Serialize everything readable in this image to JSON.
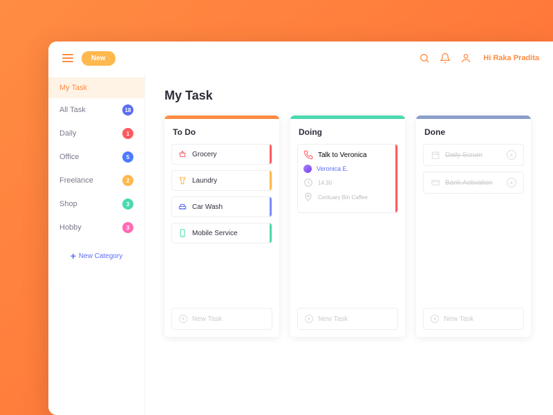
{
  "header": {
    "new_label": "New",
    "greeting": "Hi Raka Pradita"
  },
  "sidebar": {
    "items": [
      {
        "label": "My Task",
        "badge": null,
        "active": true
      },
      {
        "label": "All Task",
        "badge": "18",
        "color": "#5b6df5"
      },
      {
        "label": "Daily",
        "badge": "1",
        "color": "#ff5a5f"
      },
      {
        "label": "Office",
        "badge": "5",
        "color": "#4b7bff"
      },
      {
        "label": "Freelance",
        "badge": "2",
        "color": "#ffb84d"
      },
      {
        "label": "Shop",
        "badge": "3",
        "color": "#4cd9b0"
      },
      {
        "label": "Hobby",
        "badge": "3",
        "color": "#ff6bb5"
      }
    ],
    "new_category": "New Category"
  },
  "page_title": "My Task",
  "columns": {
    "todo": {
      "title": "To Do",
      "bar": "#ff8c42"
    },
    "doing": {
      "title": "Doing",
      "bar": "#4cd9b0"
    },
    "done": {
      "title": "Done",
      "bar": "#8a9fc9"
    }
  },
  "todo_cards": [
    {
      "label": "Grocery",
      "stripe": "#ff5a5f",
      "icon": "basket",
      "iconColor": "#ff5a5f"
    },
    {
      "label": "Laundry",
      "stripe": "#ffb84d",
      "icon": "shirt",
      "iconColor": "#ffb84d"
    },
    {
      "label": "Car Wash",
      "stripe": "#7b8cff",
      "icon": "car",
      "iconColor": "#5b6df5"
    },
    {
      "label": "Mobile Service",
      "stripe": "#4cd9b0",
      "icon": "phone",
      "iconColor": "#4cd9b0"
    }
  ],
  "doing_card": {
    "title": "Talk to Veronica",
    "person": "Veronica E.",
    "time": "14.30",
    "location": "Centuary Bin Caffee",
    "stripe": "#ff5a5f"
  },
  "done_cards": [
    {
      "label": "Daily Scrum"
    },
    {
      "label": "Bank Activation"
    }
  ],
  "new_task_label": "New Task"
}
